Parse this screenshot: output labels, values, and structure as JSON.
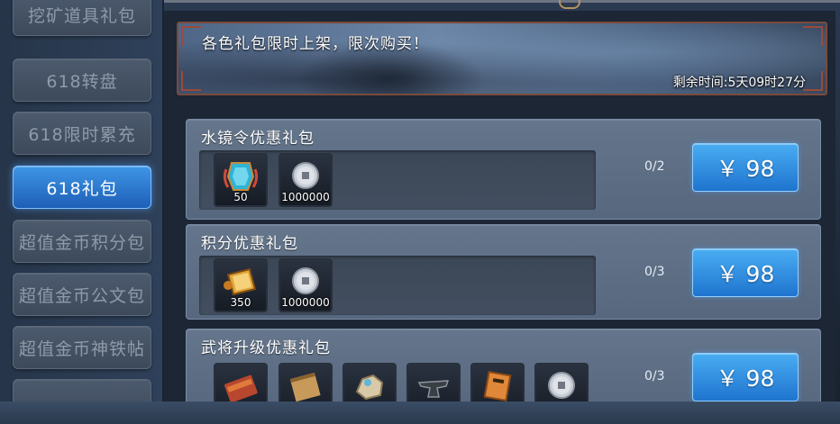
{
  "sidebar": {
    "items": [
      {
        "label": "挖矿道具礼包",
        "active": false
      },
      {
        "label": "618转盘",
        "active": false
      },
      {
        "label": "618限时累充",
        "active": false
      },
      {
        "label": "618礼包",
        "active": true
      },
      {
        "label": "超值金币积分包",
        "active": false
      },
      {
        "label": "超值金币公文包",
        "active": false
      },
      {
        "label": "超值金币神铁帖",
        "active": false
      }
    ]
  },
  "banner": {
    "title": "各色礼包限时上架，限次购买！",
    "timer": "剩余时间:5天09时27分"
  },
  "packs": [
    {
      "name": "水镜令优惠礼包",
      "limit": "0/2",
      "price": "￥ 98",
      "items": [
        {
          "icon": "blue-mirror-token-icon",
          "count": "50"
        },
        {
          "icon": "silver-coin-icon",
          "count": "1000000"
        }
      ]
    },
    {
      "name": "积分优惠礼包",
      "limit": "0/3",
      "price": "￥ 98",
      "items": [
        {
          "icon": "gold-points-scroll-icon",
          "count": "350"
        },
        {
          "icon": "silver-coin-icon",
          "count": "1000000"
        }
      ]
    },
    {
      "name": "武将升级优惠礼包",
      "limit": "0/3",
      "price": "￥ 98",
      "items": [
        {
          "icon": "red-books-icon",
          "count": ""
        },
        {
          "icon": "parchment-scroll-icon",
          "count": ""
        },
        {
          "icon": "ore-rock-icon",
          "count": ""
        },
        {
          "icon": "iron-anvil-icon",
          "count": ""
        },
        {
          "icon": "orange-scroll-icon",
          "count": ""
        },
        {
          "icon": "silver-coin-icon",
          "count": ""
        }
      ]
    }
  ],
  "colors": {
    "accent_blue": "#2f86e0",
    "panel": "#5e7088",
    "banner_border": "#7a4a3c"
  }
}
